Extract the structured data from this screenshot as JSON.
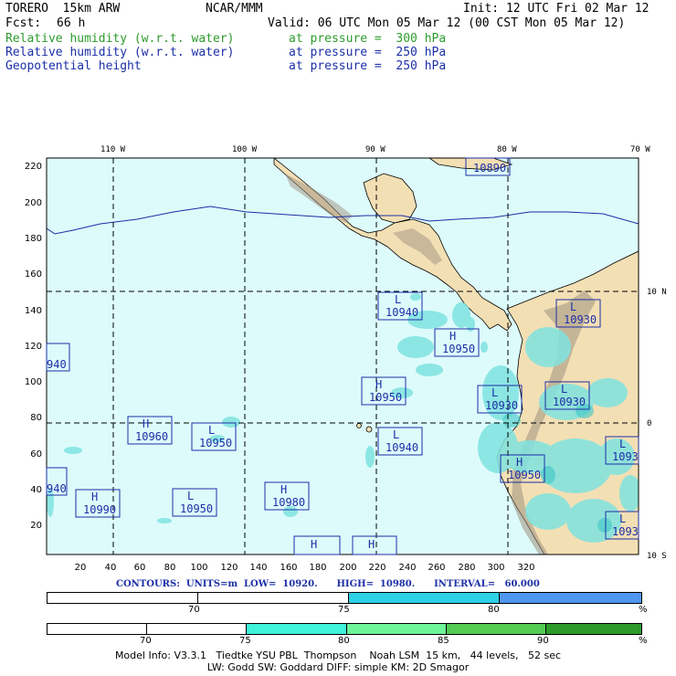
{
  "header": {
    "model": "TORERO  15km ARW",
    "center": "NCAR/MMM",
    "init": "Init: 12 UTC Fri 02 Mar 12",
    "fcst_label": "Fcst:",
    "fcst_hours": "66 h",
    "valid": "Valid: 06 UTC Mon 05 Mar 12 (00 CST Mon 05 Mar 12)"
  },
  "fields": [
    {
      "name": "Relative humidity (w.r.t. water)",
      "level": "at pressure =  300 hPa",
      "color": "#2c9b2c"
    },
    {
      "name": "Relative humidity (w.r.t. water)",
      "level": "at pressure =  250 hPa",
      "color": "#1c2fa6"
    },
    {
      "name": "Geopotential height",
      "level": "at pressure =  250 hPa",
      "color": "#1c2fa6"
    }
  ],
  "map": {
    "lon_labels": [
      "110 W",
      "100 W",
      "90 W",
      "80 W",
      "70 W"
    ],
    "lat_labels": [
      "10 N",
      "0",
      "10 S"
    ],
    "y_ticks": [
      "220",
      "200",
      "180",
      "160",
      "140",
      "120",
      "100",
      "80",
      "60",
      "40",
      "20"
    ],
    "x_ticks": [
      "20",
      "40",
      "60",
      "80",
      "100",
      "120",
      "140",
      "160",
      "180",
      "200",
      "220",
      "240",
      "260",
      "280",
      "300",
      "320"
    ],
    "ocean_color": "#ddfbfb",
    "land_color": "#f3dfb4",
    "rh_color": "#7fe3e0",
    "height_contour_color": "#1c2fa6"
  },
  "centers": [
    {
      "type": "L",
      "value": "10940"
    },
    {
      "type": "L",
      "value": "10930"
    },
    {
      "type": "H",
      "value": "10950"
    },
    {
      "type": "H",
      "value": "10950"
    },
    {
      "type": "L",
      "value": "10930"
    },
    {
      "type": "L",
      "value": "10930"
    },
    {
      "type": "H",
      "value": "10960"
    },
    {
      "type": "L",
      "value": "10950"
    },
    {
      "type": "L",
      "value": "10940"
    },
    {
      "type": "H",
      "value": "10950"
    },
    {
      "type": "H",
      "value": "10990"
    },
    {
      "type": "L",
      "value": "10950"
    },
    {
      "type": "H",
      "value": "10980"
    },
    {
      "type": "L",
      "value": "1093"
    },
    {
      "type": "L",
      "value": "1093"
    },
    {
      "type": "H",
      "value": ""
    },
    {
      "type": "H",
      "value": ""
    },
    {
      "type": "",
      "value": "940"
    },
    {
      "type": "",
      "value": "940"
    },
    {
      "type": "",
      "value": "10890"
    }
  ],
  "contours_line": "CONTOURS:  UNITS=m  LOW=  10920.      HIGH=  10980.      INTERVAL=   60.000",
  "legend1": {
    "colors": [
      "#ffffff",
      "#ffffff",
      "#2ed1e6",
      "#4f96ee"
    ],
    "labels": [
      "70",
      "75",
      "80"
    ],
    "unit": "%"
  },
  "legend2": {
    "colors": [
      "#ffffff",
      "#ffffff",
      "#ffffff",
      "#3ff2d8",
      "#6ef59a",
      "#54cc54",
      "#2c9b2c"
    ],
    "labels": [
      "70",
      "75",
      "80",
      "85",
      "90"
    ],
    "unit": "%"
  },
  "footer": {
    "line1": "Model Info: V3.3.1   Tiedtke YSU PBL  Thompson    Noah LSM  15 km,   44 levels,   52 sec",
    "line2": "LW: Godd SW: Goddard DIFF: simple KM: 2D Smagor"
  }
}
